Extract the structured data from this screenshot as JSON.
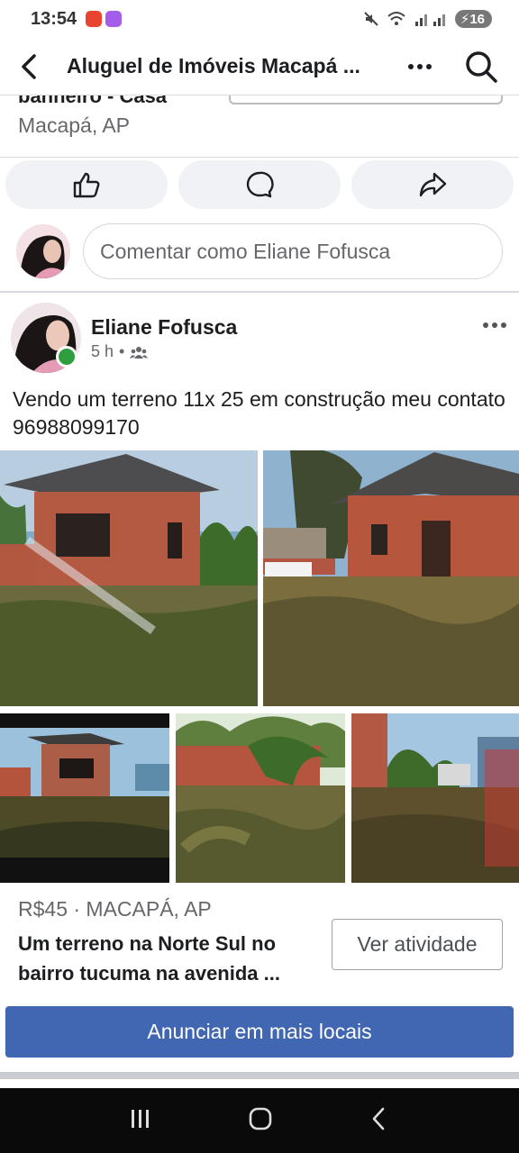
{
  "status_bar": {
    "time": "13:54",
    "battery": "16"
  },
  "header": {
    "title": "Aluguel de Imóveis Macapá ..."
  },
  "previous_post": {
    "title_fragment": "banheiro - Casa",
    "location": "Macapá, AP"
  },
  "actions": [
    {
      "icon": "like-icon"
    },
    {
      "icon": "comment-icon"
    },
    {
      "icon": "share-icon"
    }
  ],
  "comment": {
    "placeholder": "Comentar como Eliane Fofusca"
  },
  "post": {
    "author": "Eliane Fofusca",
    "time": "5 h",
    "separator": "•",
    "audience_icon": "group-icon",
    "text": "Vendo um terreno 11x 25 em construção meu contato 96988099170",
    "photo_count": 5
  },
  "listing": {
    "price_location": "R$45 · MACAPÁ, AP",
    "title": "Um terreno  na Norte Sul no bairro tucuma na avenida ...",
    "button": "Ver atividade"
  },
  "promote_button": "Anunciar em mais locais",
  "colors": {
    "accent": "#4267b2",
    "online": "#2e9e3f",
    "secondary_text": "#65676b"
  }
}
